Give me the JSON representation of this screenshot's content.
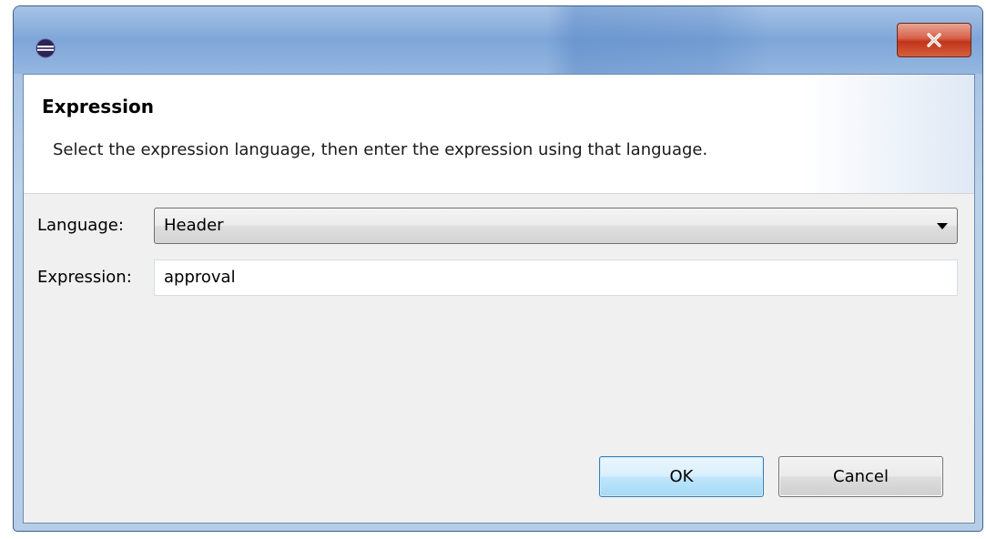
{
  "window": {
    "icon": "eclipse-icon",
    "close_icon": "close-icon",
    "close_glyph": "X"
  },
  "header": {
    "title": "Expression",
    "description": "Select the expression language, then enter the expression using that language."
  },
  "form": {
    "language_label": "Language:",
    "language_value": "Header",
    "expression_label": "Expression:",
    "expression_value": "approval"
  },
  "buttons": {
    "ok_label": "OK",
    "cancel_label": "Cancel"
  },
  "colors": {
    "ok_button_accent": "#3c7fb1",
    "close_button": "#c2351a",
    "title_bar": "#7ea6d8"
  }
}
